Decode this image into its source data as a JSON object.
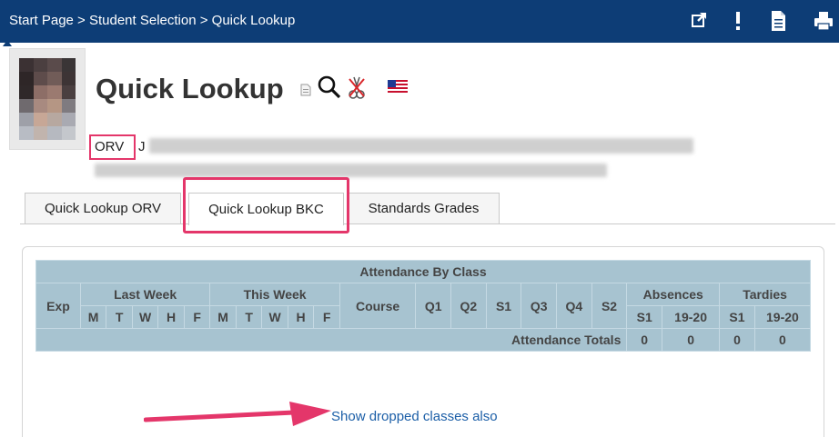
{
  "header": {
    "breadcrumb": "Start Page > Student Selection > Quick Lookup",
    "icons": [
      "external-link-icon",
      "alert-icon",
      "document-icon",
      "printer-icon"
    ]
  },
  "page": {
    "title": "Quick Lookup",
    "title_icons": [
      "document-icon",
      "search-icon",
      "no-notes-icon",
      "us-flag-icon"
    ]
  },
  "student": {
    "school_code": "ORV",
    "name_initial": "J"
  },
  "tabs": [
    {
      "label": "Quick Lookup ORV",
      "active": false
    },
    {
      "label": "Quick Lookup BKC",
      "active": true
    },
    {
      "label": "Standards Grades",
      "active": false
    }
  ],
  "attendance": {
    "title": "Attendance By Class",
    "exp": "Exp",
    "last_week": "Last Week",
    "this_week": "This Week",
    "days": [
      "M",
      "T",
      "W",
      "H",
      "F"
    ],
    "course": "Course",
    "terms": [
      "Q1",
      "Q2",
      "S1",
      "Q3",
      "Q4",
      "S2"
    ],
    "absences": "Absences",
    "tardies": "Tardies",
    "sub_cols": [
      "S1",
      "19-20",
      "S1",
      "19-20"
    ],
    "totals_label": "Attendance Totals",
    "totals": [
      "0",
      "0",
      "0",
      "0"
    ]
  },
  "footer": {
    "show_dropped": "Show dropped classes also"
  },
  "colors": {
    "header_bg": "#0d3d76",
    "table_bg": "#a7c3d0",
    "highlight": "#e4366a",
    "link": "#1b5ea7"
  }
}
